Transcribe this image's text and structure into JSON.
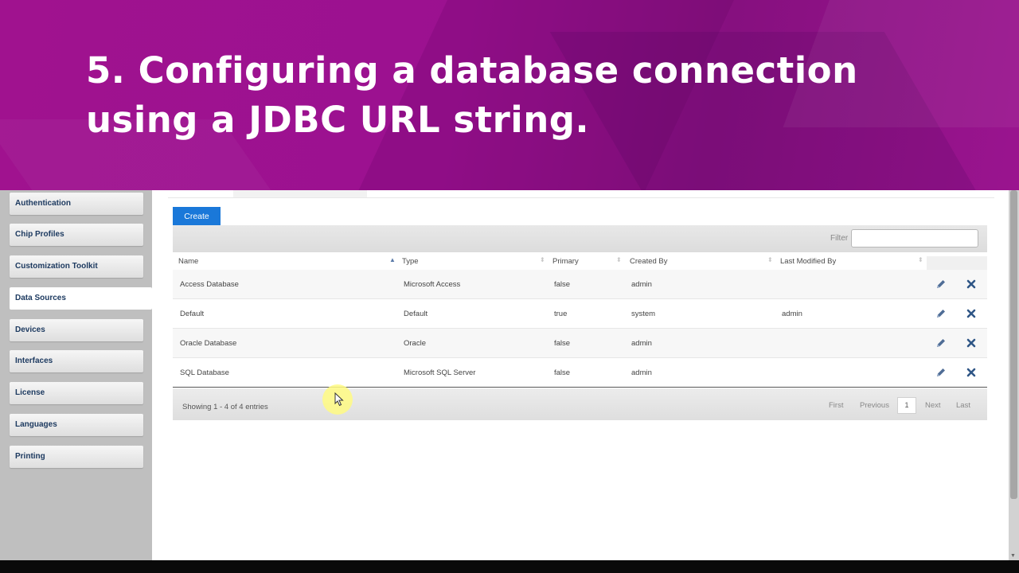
{
  "banner": {
    "title_line1": "5. Configuring a database connection",
    "title_line2": "using a JDBC URL string."
  },
  "sidebar": {
    "items": [
      {
        "label": "Authentication"
      },
      {
        "label": "Chip Profiles"
      },
      {
        "label": "Customization Toolkit"
      },
      {
        "label": "Data Sources"
      },
      {
        "label": "Devices"
      },
      {
        "label": "Interfaces"
      },
      {
        "label": "License"
      },
      {
        "label": "Languages"
      },
      {
        "label": "Printing"
      }
    ],
    "active": "Data Sources"
  },
  "toolbar": {
    "create_label": "Create",
    "filter_label": "Filter",
    "filter_value": ""
  },
  "table": {
    "columns": [
      "Name",
      "Type",
      "Primary",
      "Created By",
      "Last Modified By"
    ],
    "rows": [
      [
        "Access Database",
        "Microsoft Access",
        "false",
        "admin",
        ""
      ],
      [
        "Default",
        "Default",
        "true",
        "system",
        "admin"
      ],
      [
        "Oracle Database",
        "Oracle",
        "false",
        "admin",
        ""
      ],
      [
        "SQL Database",
        "Microsoft SQL Server",
        "false",
        "admin",
        ""
      ]
    ]
  },
  "footer": {
    "info": "Showing 1 - 4 of 4 entries",
    "first": "First",
    "previous": "Previous",
    "page": "1",
    "next": "Next",
    "last": "Last"
  },
  "colors": {
    "banner": "#9b1190",
    "accent": "#1a78d9",
    "sidebar_text": "#1d3a60",
    "icon": "#4f6d96"
  },
  "icons": {
    "edit": "pencil-icon",
    "delete": "x-icon"
  }
}
